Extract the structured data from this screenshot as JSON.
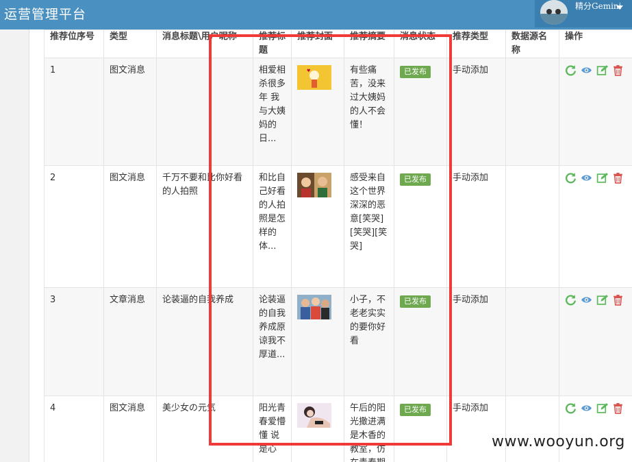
{
  "app": {
    "title": "运营管理平台"
  },
  "user": {
    "name": "精分Gemini"
  },
  "table": {
    "headers": [
      "推荐位序号",
      "类型",
      "消息标题\\用户昵称",
      "推荐标题",
      "推荐封面",
      "推荐摘要",
      "消息状态",
      "推荐类型",
      "数据源名称",
      "操作"
    ],
    "rows": [
      {
        "index": "1",
        "type": "图文消息",
        "title": "",
        "rec_title": "相爱相杀很多年 我与大姨妈的日...",
        "summary": "有些痛苦，没来过大姨妈的人不会懂！",
        "status": "已发布",
        "rec_type": "手动添加",
        "source": ""
      },
      {
        "index": "2",
        "type": "图文消息",
        "title": "千万不要和比你好看的人拍照",
        "rec_title": "和比自己好看的人拍照是怎样的体...",
        "summary": "感受来自这个世界深深的恶意[笑哭][笑哭][笑哭]",
        "status": "已发布",
        "rec_type": "手动添加",
        "source": ""
      },
      {
        "index": "3",
        "type": "文章消息",
        "title": "论装逼的自我养成",
        "rec_title": "论装逼的自我养成原谅我不厚道...",
        "summary": "小子，不老老实实的要你好看",
        "status": "已发布",
        "rec_type": "手动添加",
        "source": ""
      },
      {
        "index": "4",
        "type": "图文消息",
        "title": "美少女の元気",
        "rec_title": "阳光青春爱懵懂 说是心",
        "summary": "午后的阳光撒进满是木香的教室，仿在青春期",
        "status": "已发布",
        "rec_type": "手动添加",
        "source": ""
      }
    ]
  },
  "icons": {
    "refresh": "refresh-icon",
    "view": "eye-icon",
    "edit": "edit-icon",
    "delete": "trash-icon"
  },
  "colors": {
    "topbar": "#4a90c0",
    "badge": "#6ea84f",
    "highlight": "#f03a3a",
    "refresh": "#5cb85c",
    "view": "#5b9bd5",
    "edit": "#5cb85c",
    "delete": "#d9534f"
  },
  "watermark": "www.wooyun.org"
}
